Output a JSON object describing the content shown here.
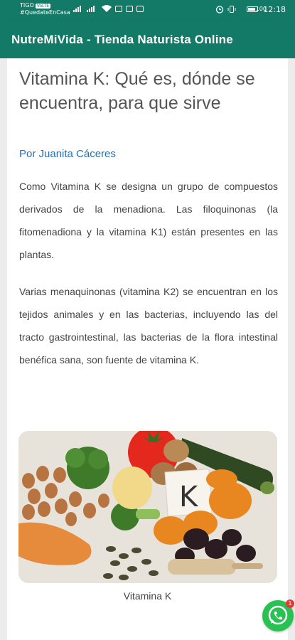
{
  "status_bar": {
    "carrier": "TIGO",
    "carrier_tag": "VoLTE",
    "hashtag": "#QuedateEnCasa",
    "battery": "100",
    "time": "12:18"
  },
  "app_bar": {
    "title": "NutreMiVida - Tienda Naturista Online"
  },
  "article": {
    "title": "Vitamina K: Qué es, dónde se encuentra, para que sirve",
    "author": "Por Juanita Cáceres",
    "paragraphs": [
      "Como Vitamina K se designa un grupo de compuestos derivados de la menadiona. Las filoquinonas (la fitomenadiona y la vitamina K1) están presentes en las plantas.",
      "Varias menaquinonas (vitamina K2) se encuentran en los tejidos animales y en las bacterias, incluyendo las del tracto gastrointestinal, las bacterias de la flora intestinal benéfica sana, son fuente de vitamina K."
    ],
    "image_letter": "K",
    "caption": "Vitamina K"
  },
  "whatsapp": {
    "badge": "1",
    "color": "#28c152"
  },
  "colors": {
    "primary": "#127a66",
    "link": "#2a6fb0"
  }
}
